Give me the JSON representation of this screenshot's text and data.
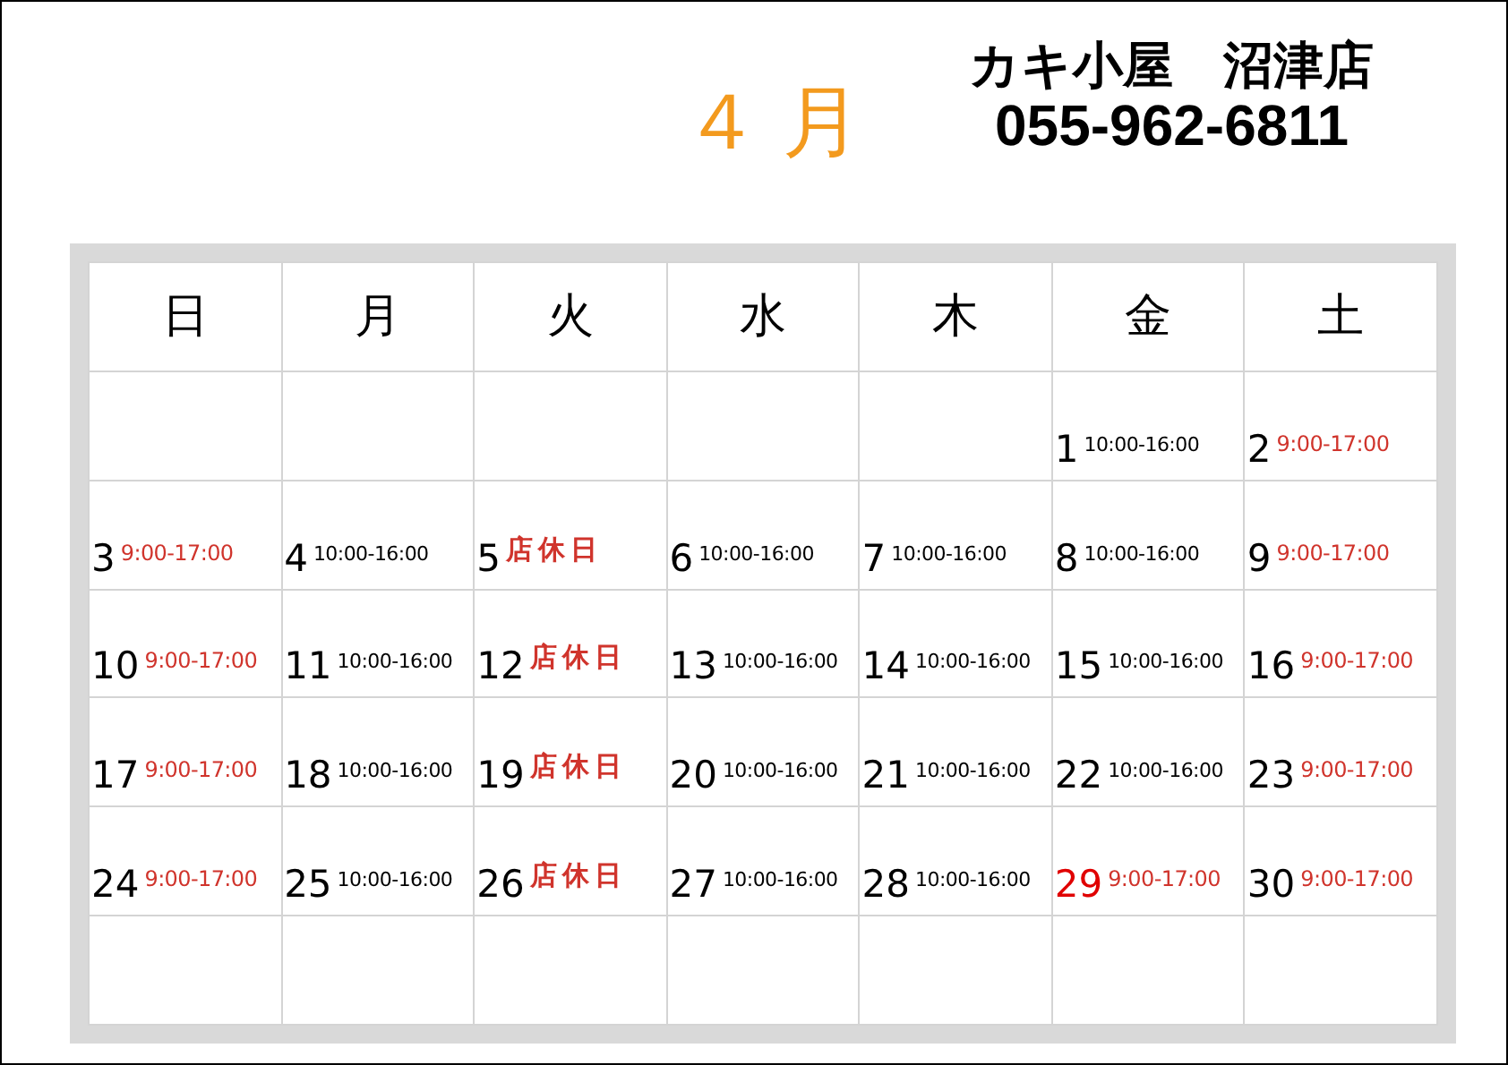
{
  "month": "４ 月",
  "store": {
    "name": "カキ小屋　沼津店",
    "phone": "055-962-6811"
  },
  "weekdays": [
    {
      "label": "日"
    },
    {
      "label": "月"
    },
    {
      "label": "火"
    },
    {
      "label": "水"
    },
    {
      "label": "木"
    },
    {
      "label": "金"
    },
    {
      "label": "土"
    }
  ],
  "weeks": [
    [
      {
        "kind": "empty"
      },
      {
        "kind": "empty"
      },
      {
        "kind": "empty"
      },
      {
        "kind": "empty"
      },
      {
        "kind": "empty"
      },
      {
        "day": "1",
        "kind": "weekday",
        "hours": "10:00-16:00",
        "holiday": false
      },
      {
        "day": "2",
        "kind": "weekend",
        "hours": "9:00-17:00",
        "holiday": false
      }
    ],
    [
      {
        "day": "3",
        "kind": "weekend",
        "hours": "9:00-17:00",
        "holiday": false
      },
      {
        "day": "4",
        "kind": "weekday",
        "hours": "10:00-16:00",
        "holiday": false
      },
      {
        "day": "5",
        "kind": "closed",
        "hours": "店休日",
        "holiday": false
      },
      {
        "day": "6",
        "kind": "weekday",
        "hours": "10:00-16:00",
        "holiday": false
      },
      {
        "day": "7",
        "kind": "weekday",
        "hours": "10:00-16:00",
        "holiday": false
      },
      {
        "day": "8",
        "kind": "weekday",
        "hours": "10:00-16:00",
        "holiday": false
      },
      {
        "day": "9",
        "kind": "weekend",
        "hours": "9:00-17:00",
        "holiday": false
      }
    ],
    [
      {
        "day": "10",
        "kind": "weekend",
        "hours": "9:00-17:00",
        "holiday": false
      },
      {
        "day": "11",
        "kind": "weekday",
        "hours": "10:00-16:00",
        "holiday": false
      },
      {
        "day": "12",
        "kind": "closed",
        "hours": "店休日",
        "holiday": false
      },
      {
        "day": "13",
        "kind": "weekday",
        "hours": "10:00-16:00",
        "holiday": false
      },
      {
        "day": "14",
        "kind": "weekday",
        "hours": "10:00-16:00",
        "holiday": false
      },
      {
        "day": "15",
        "kind": "weekday",
        "hours": "10:00-16:00",
        "holiday": false
      },
      {
        "day": "16",
        "kind": "weekend",
        "hours": "9:00-17:00",
        "holiday": false
      }
    ],
    [
      {
        "day": "17",
        "kind": "weekend",
        "hours": "9:00-17:00",
        "holiday": false
      },
      {
        "day": "18",
        "kind": "weekday",
        "hours": "10:00-16:00",
        "holiday": false
      },
      {
        "day": "19",
        "kind": "closed",
        "hours": "店休日",
        "holiday": false
      },
      {
        "day": "20",
        "kind": "weekday",
        "hours": "10:00-16:00",
        "holiday": false
      },
      {
        "day": "21",
        "kind": "weekday",
        "hours": "10:00-16:00",
        "holiday": false
      },
      {
        "day": "22",
        "kind": "weekday",
        "hours": "10:00-16:00",
        "holiday": false
      },
      {
        "day": "23",
        "kind": "weekend",
        "hours": "9:00-17:00",
        "holiday": false
      }
    ],
    [
      {
        "day": "24",
        "kind": "weekend",
        "hours": "9:00-17:00",
        "holiday": false
      },
      {
        "day": "25",
        "kind": "weekday",
        "hours": "10:00-16:00",
        "holiday": false
      },
      {
        "day": "26",
        "kind": "closed",
        "hours": "店休日",
        "holiday": false
      },
      {
        "day": "27",
        "kind": "weekday",
        "hours": "10:00-16:00",
        "holiday": false
      },
      {
        "day": "28",
        "kind": "weekday",
        "hours": "10:00-16:00",
        "holiday": false
      },
      {
        "day": "29",
        "kind": "weekend",
        "hours": "9:00-17:00",
        "holiday": true
      },
      {
        "day": "30",
        "kind": "weekend",
        "hours": "9:00-17:00",
        "holiday": false
      }
    ],
    [
      {
        "kind": "empty"
      },
      {
        "kind": "empty"
      },
      {
        "kind": "empty"
      },
      {
        "kind": "empty"
      },
      {
        "kind": "empty"
      },
      {
        "kind": "empty"
      },
      {
        "kind": "empty"
      }
    ]
  ]
}
